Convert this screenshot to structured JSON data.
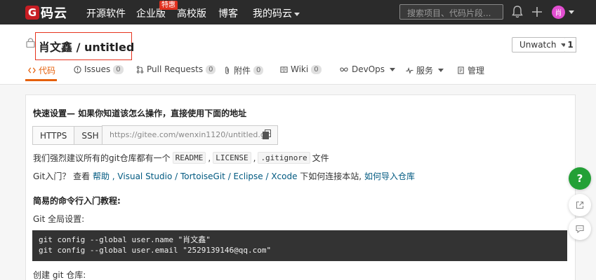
{
  "topnav": {
    "logo_mark": "G",
    "logo_text": "码云",
    "items": [
      "开源软件",
      "企业版",
      "高校版",
      "博客",
      "我的码云"
    ],
    "enterprise_badge": "特惠",
    "search_placeholder": "搜索项目、代码片段...",
    "avatar_text": "肖"
  },
  "project": {
    "title": "肖文鑫 / untitled",
    "watch_label": "Unwatch",
    "watch_count": "1"
  },
  "tabs": [
    {
      "label": "代码"
    },
    {
      "label": "Issues",
      "count": "0"
    },
    {
      "label": "Pull Requests",
      "count": "0"
    },
    {
      "label": "附件",
      "count": "0"
    },
    {
      "label": "Wiki",
      "count": "0"
    },
    {
      "label": "DevOps"
    },
    {
      "label": "服务"
    },
    {
      "label": "管理"
    }
  ],
  "quick_setup": {
    "title": "快速设置— 如果你知道该怎么操作，直接使用下面的地址",
    "protocols": [
      "HTTPS",
      "SSH"
    ],
    "url": "https://gitee.com/wenxin1120/untitled.git",
    "recommend_prefix": "我们强烈建议所有的git仓库都有一个",
    "recommend_files": [
      "README",
      "LICENSE",
      ".gitignore"
    ],
    "recommend_suffix": "文件",
    "git_intro_prefix": "Git入门？ 查看 ",
    "git_intro_help": "帮助",
    "git_intro_tools": " , Visual Studio / TortoiseGit / Eclipse / Xcode",
    "git_intro_middle": " 下如何连接本站, ",
    "git_intro_import": "如何导入仓库"
  },
  "tutorial": {
    "title": "简易的命令行入门教程:",
    "git_setup_label": "Git 全局设置:",
    "code_lines": [
      "git config --global user.name \"肖文鑫\"",
      "git config --global user.email \"2529139146@qq.com\""
    ],
    "create_label": "创建 git 仓库:"
  },
  "floating": {
    "help_label": "?"
  }
}
